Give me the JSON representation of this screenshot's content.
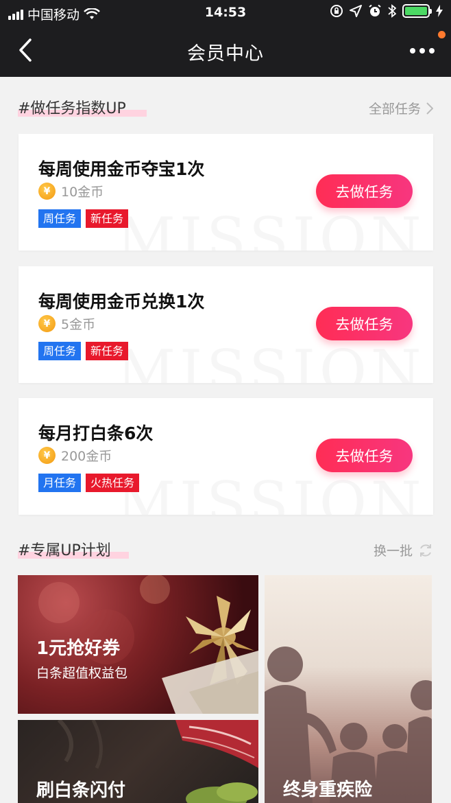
{
  "status_bar": {
    "carrier": "中国移动",
    "time": "14:53"
  },
  "nav": {
    "title": "会员中心"
  },
  "tasks_section": {
    "title": "#做任务指数UP",
    "link": "全部任务",
    "button_label": "去做任务",
    "watermark": "MISSION",
    "coin_symbol": "¥",
    "items": [
      {
        "title": "每周使用金币夺宝1次",
        "reward": "10金币",
        "tags": [
          "周任务",
          "新任务"
        ]
      },
      {
        "title": "每周使用金币兑换1次",
        "reward": "5金币",
        "tags": [
          "周任务",
          "新任务"
        ]
      },
      {
        "title": "每月打白条6次",
        "reward": "200金币",
        "tags": [
          "月任务",
          "火热任务"
        ]
      }
    ]
  },
  "plan_section": {
    "title": "#专属UP计划",
    "link": "换一批",
    "tiles": [
      {
        "title": "1元抢好券",
        "subtitle": "白条超值权益包"
      },
      {
        "title": "终身重疾险"
      },
      {
        "title": "刷白条闪付"
      }
    ]
  },
  "colors": {
    "accent": "#ff2d55",
    "tag_blue": "#2274f0",
    "tag_red": "#e8192c",
    "highlight": "#ffd3e0"
  }
}
